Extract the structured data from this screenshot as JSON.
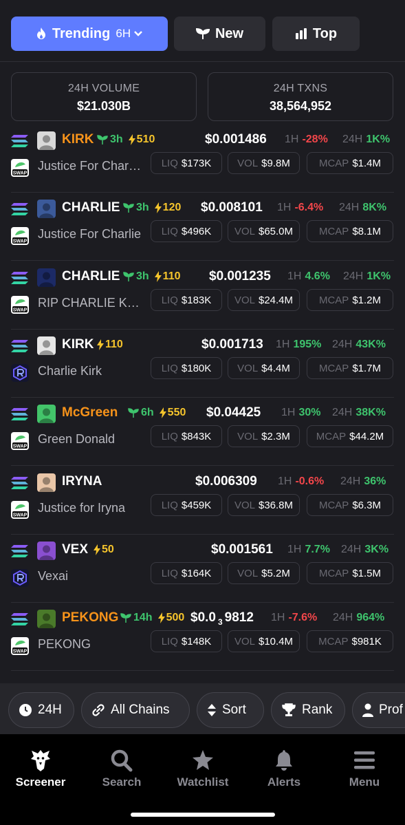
{
  "tabs": [
    {
      "label": "Trending",
      "sub": "6H",
      "icon": "flame-icon"
    },
    {
      "label": "New",
      "icon": "sprout-icon"
    },
    {
      "label": "Top",
      "icon": "bar-chart-icon"
    }
  ],
  "stats": {
    "volume": {
      "label": "24H VOLUME",
      "value": "$21.030B"
    },
    "txns": {
      "label": "24H TXNS",
      "value": "38,564,952"
    }
  },
  "labels": {
    "h1": "1H",
    "h24": "24H",
    "liq": "LIQ",
    "vol": "VOL",
    "mcap": "MCAP"
  },
  "tokens": [
    {
      "symbol": "KIRK",
      "symbol_color": "orange",
      "age": "3h",
      "boost": "510",
      "price": "$0.001486",
      "change_1h": "-28%",
      "change_1h_color": "red",
      "change_24h": "1K%",
      "change_24h_color": "green",
      "name": "Justice For Charlie Kirk",
      "dex": "swap",
      "liq": "$173K",
      "vol": "$9.8M",
      "mcap": "$1.4M",
      "avatar_color": "#d9d9d9"
    },
    {
      "symbol": "CHARLIE",
      "symbol_color": "white",
      "age": "3h",
      "boost": "120",
      "price": "$0.008101",
      "change_1h": "-6.4%",
      "change_1h_color": "red",
      "change_24h": "8K%",
      "change_24h_color": "green",
      "name": "Justice For Charlie",
      "dex": "swap",
      "liq": "$496K",
      "vol": "$65.0M",
      "mcap": "$8.1M",
      "avatar_color": "#3b5a9a"
    },
    {
      "symbol": "CHARLIE",
      "symbol_color": "white",
      "age": "3h",
      "boost": "110",
      "price": "$0.001235",
      "change_1h": "4.6%",
      "change_1h_color": "green",
      "change_24h": "1K%",
      "change_24h_color": "green",
      "name": "RIP CHARLIE KIRK",
      "dex": "swap",
      "liq": "$183K",
      "vol": "$24.4M",
      "mcap": "$1.2M",
      "avatar_color": "#1c2a66"
    },
    {
      "symbol": "KIRK",
      "symbol_color": "white",
      "age": "",
      "boost": "110",
      "price": "$0.001713",
      "change_1h": "195%",
      "change_1h_color": "green",
      "change_24h": "43K%",
      "change_24h_color": "green",
      "name": "Charlie Kirk",
      "dex": "raydium",
      "liq": "$180K",
      "vol": "$4.4M",
      "mcap": "$1.7M",
      "avatar_color": "#e6e6e6"
    },
    {
      "symbol": "McGreen",
      "symbol_color": "orange",
      "age": "6h",
      "boost": "550",
      "price": "$0.04425",
      "change_1h": "30%",
      "change_1h_color": "green",
      "change_24h": "38K%",
      "change_24h_color": "green",
      "name": "Green Donald",
      "dex": "swap",
      "liq": "$843K",
      "vol": "$2.3M",
      "mcap": "$44.2M",
      "avatar_color": "#43c46a"
    },
    {
      "symbol": "IRYNA",
      "symbol_color": "white",
      "age": "",
      "boost": "",
      "price": "$0.006309",
      "change_1h": "-0.6%",
      "change_1h_color": "red",
      "change_24h": "36%",
      "change_24h_color": "green",
      "name": "Justice for Iryna",
      "dex": "swap",
      "liq": "$459K",
      "vol": "$36.8M",
      "mcap": "$6.3M",
      "avatar_color": "#e9c6a8"
    },
    {
      "symbol": "VEX",
      "symbol_color": "white",
      "age": "",
      "boost": "50",
      "price": "$0.001561",
      "change_1h": "7.7%",
      "change_1h_color": "green",
      "change_24h": "3K%",
      "change_24h_color": "green",
      "name": "Vexai",
      "dex": "raydium",
      "liq": "$164K",
      "vol": "$5.2M",
      "mcap": "$1.5M",
      "avatar_color": "#8a4fd0"
    },
    {
      "symbol": "PEKONG",
      "symbol_color": "orange",
      "age": "14h",
      "boost": "500",
      "price_main": "$0.0",
      "price_sub": "3",
      "price_tail": "9812",
      "change_1h": "-7.6%",
      "change_1h_color": "red",
      "change_24h": "964%",
      "change_24h_color": "green",
      "name": "PEKONG",
      "dex": "swap",
      "liq": "$148K",
      "vol": "$10.4M",
      "mcap": "$981K",
      "avatar_color": "#4a7a2a"
    }
  ],
  "filters": [
    {
      "label": "24H",
      "icon": "clock-icon"
    },
    {
      "label": "All Chains",
      "icon": "link-icon"
    },
    {
      "label": "Sort",
      "icon": "sort-icon"
    },
    {
      "label": "Rank",
      "icon": "trophy-icon"
    },
    {
      "label": "Prof",
      "icon": "user-icon"
    }
  ],
  "nav": [
    {
      "label": "Screener",
      "icon": "eagle-icon",
      "active": true
    },
    {
      "label": "Search",
      "icon": "search-icon"
    },
    {
      "label": "Watchlist",
      "icon": "star-icon"
    },
    {
      "label": "Alerts",
      "icon": "bell-icon"
    },
    {
      "label": "Menu",
      "icon": "menu-icon"
    }
  ],
  "colors": {
    "accent": "#5f7cff",
    "green": "#3ec46d",
    "red": "#f2464a",
    "boost": "#f5c42c",
    "orange": "#f7931a"
  }
}
